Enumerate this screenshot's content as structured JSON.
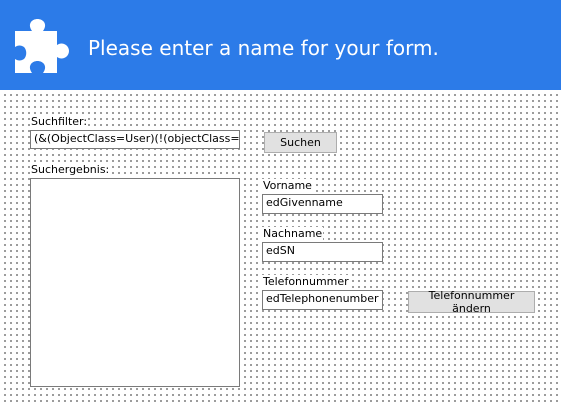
{
  "header": {
    "title": "Please enter a name for your form.",
    "icon": "puzzle-piece-icon",
    "background_color": "#2c7be8"
  },
  "form": {
    "search_filter_label": "Suchfilter:",
    "search_filter_value": "(&(ObjectClass=User)(!(objectClass=Comp",
    "search_button_label": "Suchen",
    "search_result_label": "Suchergebnis:",
    "given_name_label": "Vorname",
    "given_name_value": "edGivenname",
    "surname_label": "Nachname",
    "surname_value": "edSN",
    "phone_label": "Telefonnummer",
    "phone_value": "edTelephonenumber",
    "change_phone_button_label": "Telefonnummer ändern"
  }
}
